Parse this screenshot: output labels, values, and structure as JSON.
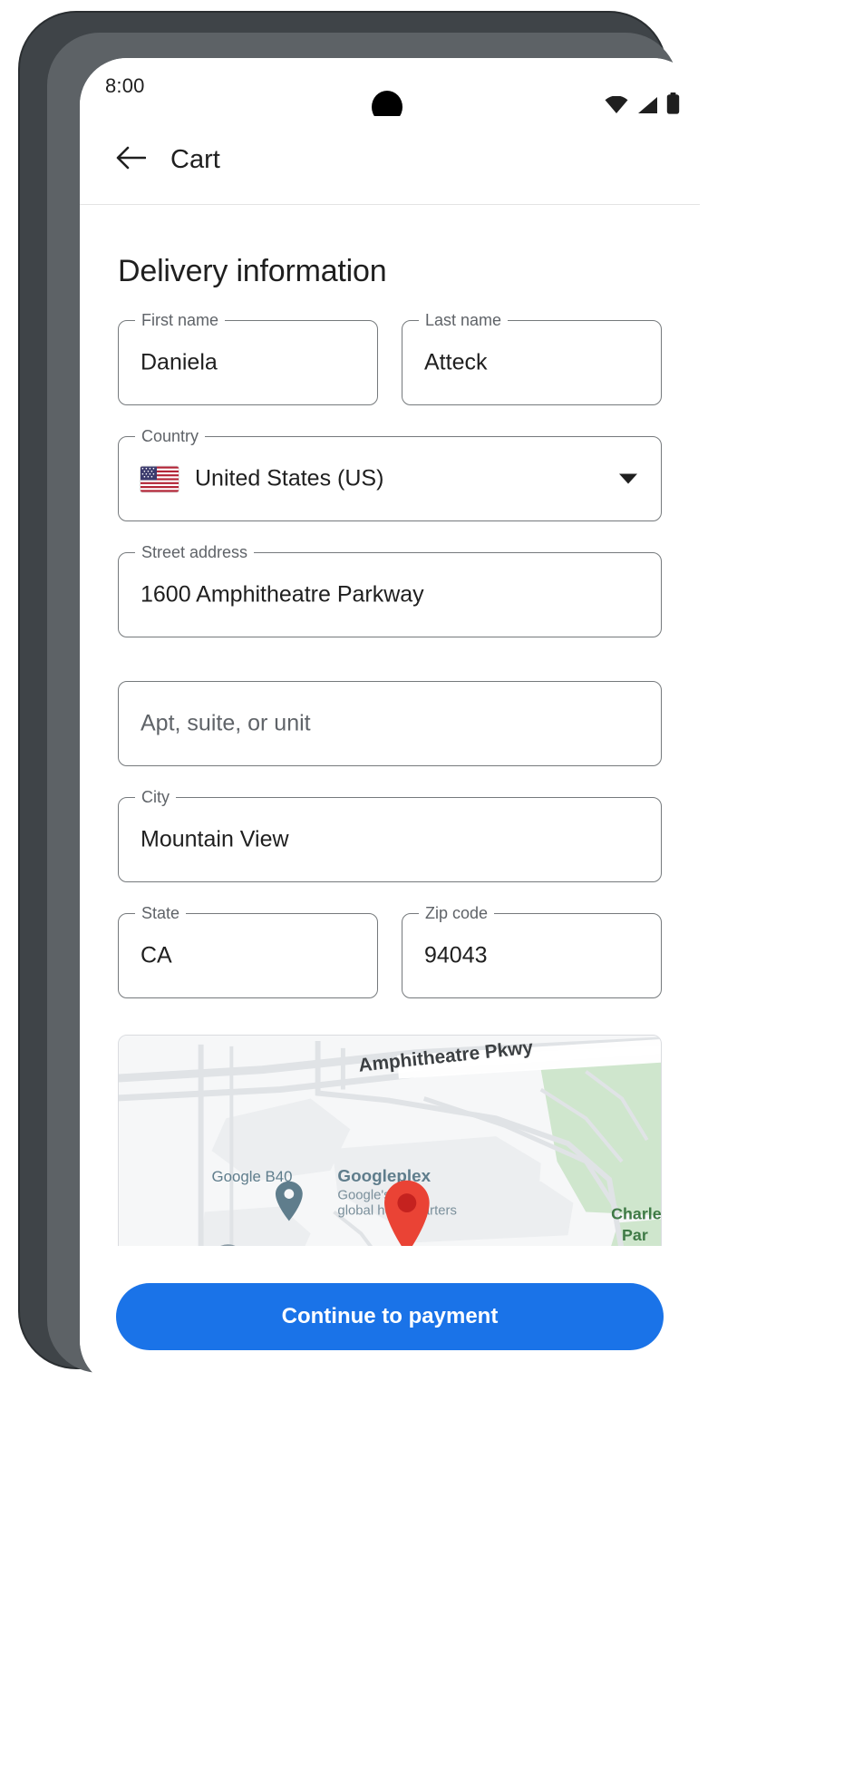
{
  "status_bar": {
    "time": "8:00",
    "icons": [
      "wifi-icon",
      "cellular-signal-icon",
      "battery-icon"
    ]
  },
  "app_bar": {
    "back_icon": "arrow-back-icon",
    "title": "Cart"
  },
  "main": {
    "section_title": "Delivery information",
    "fields": [
      {
        "name": "first-name",
        "label": "First name",
        "value": "Daniela",
        "placeholder": ""
      },
      {
        "name": "last-name",
        "label": "Last name",
        "value": "Atteck",
        "placeholder": ""
      },
      {
        "name": "country",
        "label": "Country",
        "value": "United States (US)",
        "placeholder": "",
        "icon": "us-flag-icon",
        "caret": "chevron-down-icon"
      },
      {
        "name": "street-address",
        "label": "Street address",
        "value": "1600 Amphitheatre Parkway",
        "placeholder": ""
      },
      {
        "name": "apt-suite-unit",
        "label": "",
        "value": "",
        "placeholder": "Apt, suite, or unit"
      },
      {
        "name": "city",
        "label": "City",
        "value": "Mountain View",
        "placeholder": ""
      },
      {
        "name": "state",
        "label": "State",
        "value": "CA",
        "placeholder": ""
      },
      {
        "name": "zip-code",
        "label": "Zip code",
        "value": "94043",
        "placeholder": ""
      }
    ],
    "map": {
      "street_label": "Amphitheatre Pkwy",
      "poi_b40": "Google B40",
      "poi_googleplex": "Googleplex",
      "poi_googleplex_sub1": "Google's large",
      "poi_googleplex_sub2": "global headquarters",
      "park_label_1": "Charle",
      "park_label_2": "Par",
      "marker": "location-pin-icon"
    }
  },
  "bottom_bar": {
    "continue_label": "Continue to payment"
  },
  "colors": {
    "accent": "#1a73e8",
    "marker": "#ea4335",
    "poi_pin": "#5f7d8c",
    "text_primary": "#1f1f1f",
    "text_secondary": "#5f6368",
    "field_border": "#75797c",
    "park_green": "#cfe6cd"
  }
}
